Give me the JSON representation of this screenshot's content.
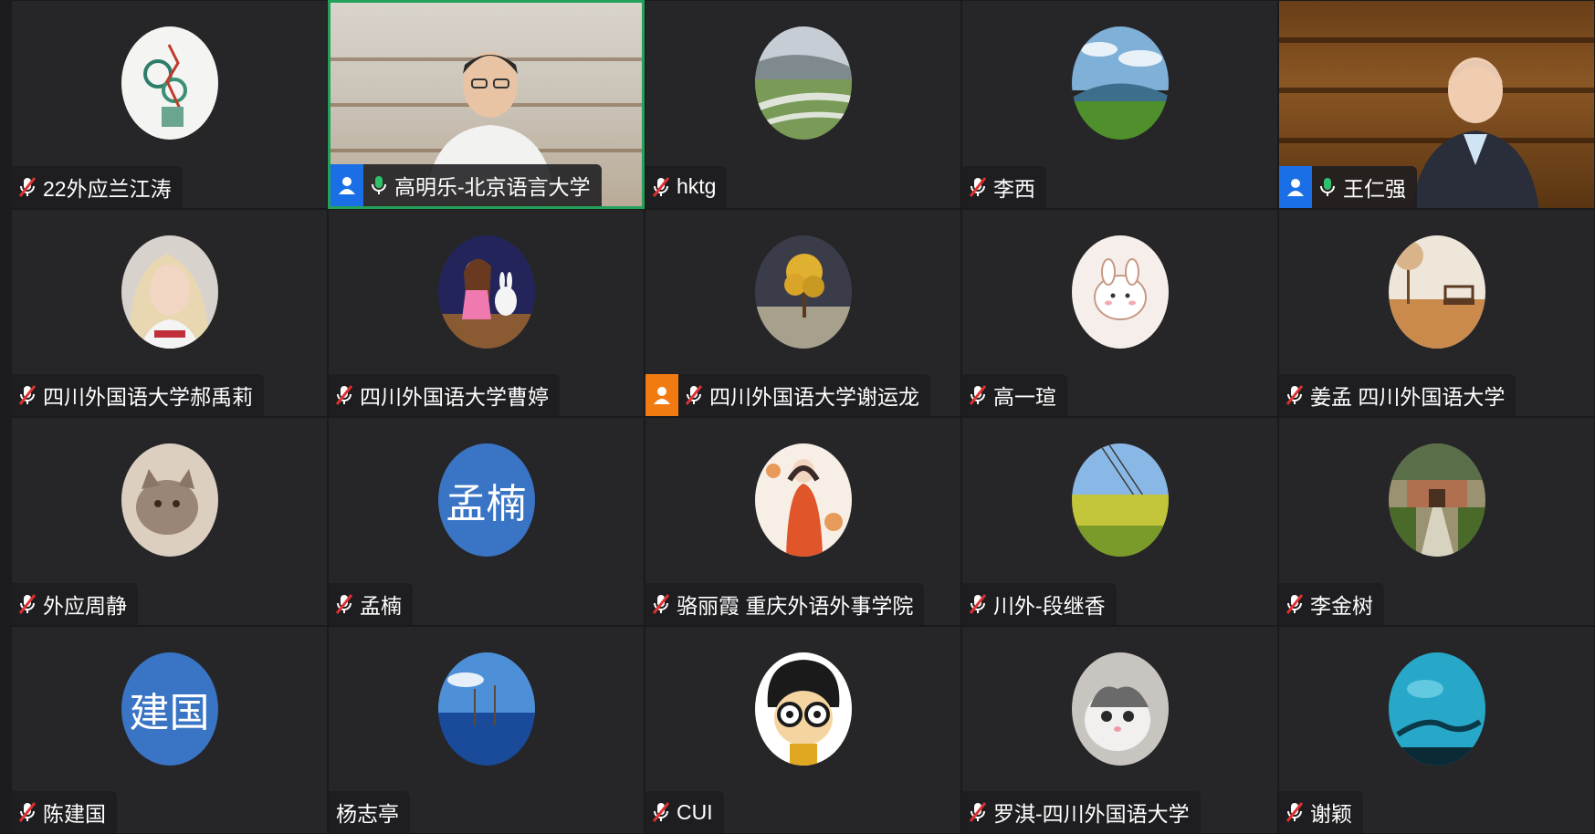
{
  "participants": [
    {
      "name": "22外应兰江涛",
      "muted": true
    },
    {
      "name": "高明乐-北京语言大学",
      "muted": false
    },
    {
      "name": "hktg",
      "muted": true
    },
    {
      "name": "李西",
      "muted": true
    },
    {
      "name": "王仁强",
      "muted": false
    },
    {
      "name": "四川外国语大学郝禹莉",
      "muted": true
    },
    {
      "name": "四川外国语大学曹婷",
      "muted": true
    },
    {
      "name": "四川外国语大学谢运龙",
      "muted": true
    },
    {
      "name": "高一瑄",
      "muted": true
    },
    {
      "name": "姜孟 四川外国语大学",
      "muted": true
    },
    {
      "name": "外应周静",
      "muted": true
    },
    {
      "name": "孟楠",
      "muted": true,
      "initials": "孟楠"
    },
    {
      "name": "骆丽霞 重庆外语外事学院",
      "muted": true
    },
    {
      "name": "川外-段继香",
      "muted": true
    },
    {
      "name": "李金树",
      "muted": true
    },
    {
      "name": "陈建国",
      "muted": true,
      "initials": "建国"
    },
    {
      "name": "杨志亭"
    },
    {
      "name": "CUI",
      "muted": true
    },
    {
      "name": "罗淇-四川外国语大学",
      "muted": true
    },
    {
      "name": "谢颖",
      "muted": true
    }
  ],
  "colors": {
    "active_speaker_border": "#23a15b",
    "initials_avatar_bg": "#3a74c4",
    "host_badge": "#1b6fe6",
    "cohost_badge": "#f17b10",
    "muted_mic": "#e03030",
    "live_mic": "#2ec16a"
  }
}
